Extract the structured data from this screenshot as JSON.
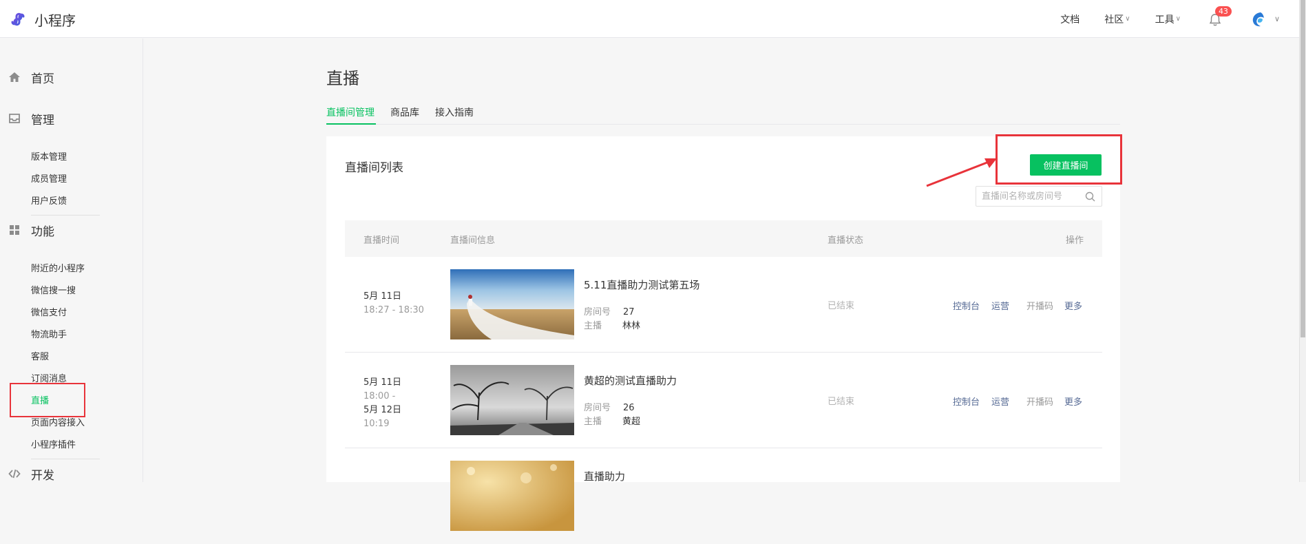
{
  "app": {
    "brand_name": "小程序"
  },
  "topnav": {
    "docs": "文档",
    "community": "社区",
    "tools": "工具",
    "notification_count": "43"
  },
  "sidebar": {
    "home": "首页",
    "manage": {
      "label": "管理",
      "items": [
        "版本管理",
        "成员管理",
        "用户反馈"
      ]
    },
    "features": {
      "label": "功能",
      "items": [
        "附近的小程序",
        "微信搜一搜",
        "微信支付",
        "物流助手",
        "客服",
        "订阅消息",
        "直播",
        "页面内容接入",
        "小程序插件"
      ]
    },
    "develop": {
      "label": "开发"
    },
    "active_item": "直播"
  },
  "main": {
    "title": "直播",
    "tabs": [
      {
        "label": "直播间管理",
        "active": true
      },
      {
        "label": "商品库",
        "active": false
      },
      {
        "label": "接入指南",
        "active": false
      }
    ],
    "list_title": "直播间列表",
    "create_button": "创建直播间",
    "search_placeholder": "直播间名称或房间号",
    "columns": {
      "time": "直播时间",
      "info": "直播间信息",
      "status": "直播状态",
      "actions": "操作"
    },
    "labels": {
      "room_no": "房间号",
      "anchor": "主播"
    },
    "rows": [
      {
        "time_line1": "5月 11日",
        "time_line2": "18:27 - 18:30",
        "name": "5.11直播助力测试第五场",
        "room_no": "27",
        "anchor": "林林",
        "status": "已结束",
        "thumb": "wedding-dress-field"
      },
      {
        "time_line1": "5月 11日",
        "time_line2": "18:00 -",
        "time_line3": "5月 12日",
        "time_line4": "10:19",
        "name": "黄超的测试直播助力",
        "room_no": "26",
        "anchor": "黄超",
        "status": "已结束",
        "thumb": "bw-trees-fog"
      },
      {
        "name": "直播助力",
        "thumb": "golden-bokeh"
      }
    ],
    "actions": [
      "控制台",
      "运营",
      "开播码",
      "更多"
    ]
  },
  "colors": {
    "accent": "#07c160",
    "link": "#576b95",
    "annotation": "#e8333a",
    "badge": "#fa5151"
  }
}
